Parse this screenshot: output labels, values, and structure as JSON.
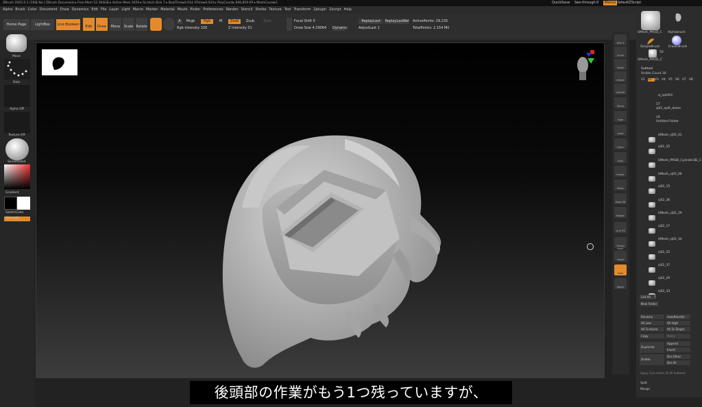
{
  "titlebar": {
    "text": "ZBrush 2025.0.1 [19号 No.]   ZBrush Document      ▸ Free Mem 52.394GB ▸ Active Mem 1659 ▸ Scratch Disk 7 ▸  BoolTime▸0.014 ATime▸0.024 ▸ PolyCount▸ 846.859 KP ▸ MeshCount▸3"
  },
  "top_right": {
    "quicksave": "QuickSave",
    "seethrough": "See-through",
    "seethrough_val": "0",
    "menus": "Menus",
    "zscript": "DefaultZScript"
  },
  "menu": [
    "Alpha",
    "Brush",
    "Color",
    "Document",
    "Draw",
    "Dynamics",
    "Edit",
    "File",
    "Layer",
    "Light",
    "Macro",
    "Marker",
    "Material",
    "Movie",
    "Picker",
    "Preferences",
    "Render",
    "Stencil",
    "Stroke",
    "Texture",
    "Tool",
    "Transform",
    "Zplugin",
    "Zscript",
    "Help"
  ],
  "toolbar": {
    "home": "Home Page",
    "lightbox": "LightBox",
    "live_boolean": "Live Boolean",
    "edit": "Edit",
    "draw": "Draw",
    "move": "Move",
    "scale": "Scale",
    "rotate": "Rotate",
    "a": "A",
    "mrgb": "Mrgb",
    "rgb": "Rgb",
    "m": "M",
    "rgb_intensity": "Rgb Intensity 100",
    "zadd": "Zadd",
    "zsub": "Zsub",
    "zcut": "Zcut",
    "z_intensity": "Z Intensity 51",
    "focal_shift": "Focal Shift 0",
    "draw_size": "Draw Size 4.29064",
    "dynamic": "Dynamic",
    "replay_last": "ReplayLast",
    "replay_last_rel": "ReplayLastRel",
    "adjust_last": "AdjustLast 1",
    "active_points": "ActivePoints: 29,235",
    "total_points": "TotalPoints: 2.154 Mil"
  },
  "left_panel": {
    "brush": "Move",
    "stroke": "Dots",
    "alpha": "Alpha Off",
    "texture": "Texture Off",
    "material": "SkinShade4",
    "gradient": "Gradient",
    "switch_color": "SwitchColor",
    "alternate": "Alternate"
  },
  "right_strip": [
    "SPix 3",
    "Scroll",
    "Zoom",
    "Actual",
    "AAHalf",
    "Persp",
    "Floor",
    "Local",
    "LSym",
    "Gxyz",
    "Frame",
    "Move",
    "Zoom3D",
    "Rotate",
    "Line Fill PolyF",
    "Transp",
    "Ghost",
    "Solo",
    "Xpose"
  ],
  "right_panel": {
    "tools": [
      "UMesh_PM3D_C",
      "Alphabrush",
      "SimpleBrush",
      "EraserBrush",
      "UMesh_PM3D_C"
    ],
    "tool_count": "50",
    "tool_count2": "63",
    "subtool_title": "Subtool",
    "visible_count": "Visible Count 18",
    "versions": [
      "V1",
      "V2",
      "V3",
      "V4",
      "V5",
      "V6",
      "V7",
      "V8"
    ],
    "items": [
      {
        "name": "sj_split03",
        "orange": false
      },
      {
        "name": "17",
        "orange": true
      },
      {
        "name": "sj01_split_dome",
        "orange": true
      },
      {
        "name": "19",
        "orange": true
      },
      {
        "name": "Untitled Folder",
        "orange": true
      },
      {
        "name": "UMesh_sj05_01",
        "orange": false
      },
      {
        "name": "sj02_35",
        "orange": false
      },
      {
        "name": "UMesh_PM3D_Cylinder3D_1",
        "orange": false
      },
      {
        "name": "UMesh_sj03_06",
        "orange": false
      },
      {
        "name": "sj02_15",
        "orange": false
      },
      {
        "name": "sj02_36",
        "orange": false
      },
      {
        "name": "UMesh_sj02_29",
        "orange": false
      },
      {
        "name": "sj02_17",
        "orange": false
      },
      {
        "name": "UMesh_sj02_34",
        "orange": false
      },
      {
        "name": "sj02_32",
        "orange": false
      },
      {
        "name": "sj02_37",
        "orange": false
      },
      {
        "name": "sj02_20",
        "orange": false
      },
      {
        "name": "sj02_33",
        "orange": false
      }
    ],
    "list_all": "List All",
    "new_folder": "New Folder",
    "rename": "Rename",
    "auto_reorder": "AutoReorder",
    "all_low": "All Low",
    "all_high": "All High",
    "all_to_home": "All To Home",
    "all_to_target": "All To Target",
    "copy": "Copy",
    "paste": "Paste",
    "duplicate": "Duplicate",
    "append": "Append",
    "insert": "Insert",
    "delete": "Delete",
    "del_other": "Del Other",
    "del_all": "Del All",
    "apply_care": "Apply Care Action To All Subtools",
    "split": "Split",
    "merge": "Merge"
  },
  "subtitle": "後頭部の作業がもう1つ残っていますが、",
  "colors": {
    "accent": "#e38b2c",
    "panel": "#2c2c2c",
    "viewport_top": "#000000"
  }
}
